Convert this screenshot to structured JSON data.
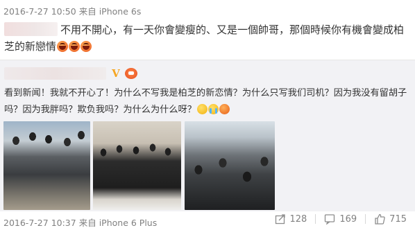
{
  "post": {
    "date": "2016-7-27",
    "time": "10:50",
    "source_prefix": "来自",
    "device": "iPhone 6s",
    "text": "不用不開心，有一天你會變瘦的、又是一個帥哥，那個時候你有機會變成柏芝的新戀情",
    "emojis": [
      "laugh-emoji",
      "laugh-emoji",
      "laugh-emoji"
    ]
  },
  "repost": {
    "badges": [
      "vip-v-icon",
      "vip-level-icon"
    ],
    "text": "看到新闻！我就不开心了！为什么不写我是柏芝的新恋情？为什么只写我们司机？因为我没有留胡子吗？因为我胖吗？欺负我吗？为什么为什么呀？",
    "emojis": [
      "thinking-emoji",
      "crying-emoji",
      "angry-emoji"
    ],
    "photos": [
      "photo-1",
      "photo-2",
      "photo-3"
    ],
    "date": "2016-7-27",
    "time": "10:37",
    "source_prefix": "来自",
    "device": "iPhone 6 Plus",
    "share_count": "128",
    "comment_count": "169",
    "like_count": "715"
  }
}
